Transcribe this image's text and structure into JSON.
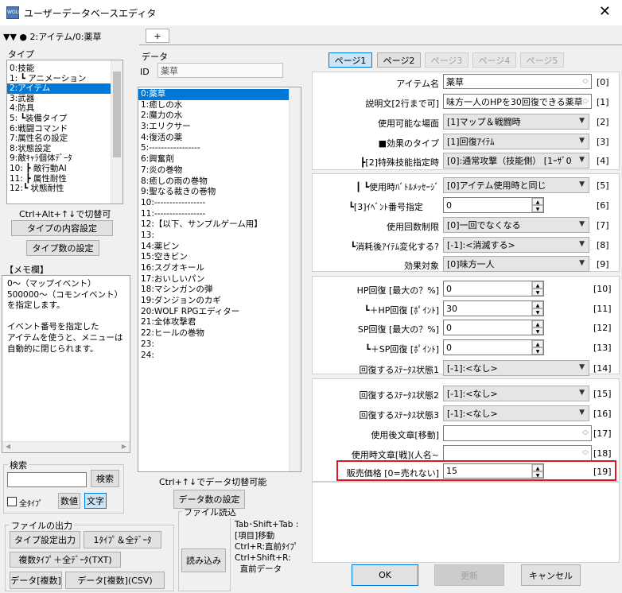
{
  "window": {
    "title": "ユーザーデータベースエディタ",
    "close": "✕",
    "app_icon": "WOLF"
  },
  "tabs": {
    "current": "▼▼ ● 2:アイテム/0:薬草",
    "add": "+"
  },
  "type_panel": {
    "label": "タイプ",
    "items": [
      "0:技能",
      "1: ┗ アニメーション",
      "2:アイテム",
      "3:武器",
      "4:防具",
      "5: ┗装備タイプ",
      "6:戦闘コマンド",
      "7:属性名の設定",
      "8:状態設定",
      "9:敵ｷｬﾗ個体ﾃﾞｰﾀ",
      "10: ┣ 敵行動AI",
      "11: ┣ 属性耐性",
      "12:┗ 状態耐性"
    ],
    "selected": 2,
    "hint": "Ctrl+Alt+↑↓で切替可",
    "content_button": "タイプの内容設定",
    "count_button": "タイプ数の設定"
  },
  "memo": {
    "label": "【メモ欄】",
    "lines": [
      "0～（マップイベント）",
      "500000～（コモンイベント）",
      "を指定します。",
      "",
      "イベント番号を指定した",
      "アイテムを使うと、メニューは",
      "自動的に閉じられます。"
    ]
  },
  "search": {
    "label": "検索",
    "button": "検索",
    "all_types": "全ﾀｲﾌﾟ",
    "numeric": "数値",
    "text": "文字"
  },
  "file_output": {
    "label": "ファイルの出力",
    "type_settings": "タイプ設定出力",
    "one_type_all": "1ﾀｲﾌﾟ＆全ﾃﾞｰﾀ",
    "multi_type": "複数ﾀｲﾌﾟ＋全ﾃﾞｰﾀ(TXT)",
    "data_multi": "データ[複数]",
    "data_multi_csv": "データ[複数](CSV)"
  },
  "file_read": {
    "label": "ファイル読込",
    "button": "読み込み"
  },
  "shortcuts": [
    "Tab･Shift+Tab :",
    "[項目]移動",
    "Ctrl+R:直前ﾀｲﾌﾟ",
    "Ctrl+Shift+R:",
    "  直前データ"
  ],
  "data_panel": {
    "label": "データ",
    "id_label": "ID",
    "id_value": "薬草",
    "items": [
      "0:薬草",
      "1:癒しの水",
      "2:魔力の水",
      "3:エリクサー",
      "4:復活の薬",
      "5:-----------------",
      "6:興奮剤",
      "7:炎の巻物",
      "8:癒しの雨の巻物",
      "9:聖なる裁きの巻物",
      "10:-----------------",
      "11:-----------------",
      "12:【以下、サンプルゲーム用】",
      "13:",
      "14:薬ビン",
      "15:空きビン",
      "16:スグオキール",
      "17:おいしいパン",
      "18:マシンガンの弾",
      "19:ダンジョンのカギ",
      "20:WOLF RPGエディター",
      "21:全体攻撃君",
      "22:ヒールの巻物",
      "23:",
      "24:"
    ],
    "selected": 0,
    "hint": "Ctrl+↑↓でデータ切替可能",
    "count_button": "データ数の設定"
  },
  "pages": [
    {
      "label": "ページ1",
      "state": "active"
    },
    {
      "label": "ページ2",
      "state": "normal"
    },
    {
      "label": "ページ3",
      "state": "disabled"
    },
    {
      "label": "ページ4",
      "state": "disabled"
    },
    {
      "label": "ページ5",
      "state": "disabled"
    }
  ],
  "fields": {
    "item_name": {
      "label": "アイテム名",
      "value": "薬草",
      "num": "[0]"
    },
    "description": {
      "label": "説明文[2行まで可]",
      "value": "味方一人のHPを30回復できる薬草",
      "num": "[1]"
    },
    "usable_scene": {
      "label": "使用可能な場面",
      "value": "[1]マップ＆戦闘時",
      "num": "[2]"
    },
    "effect_type": {
      "label": "■効果のタイプ",
      "value": "[1]回復ｱｲﾃﾑ",
      "num": "[3]"
    },
    "special_skill": {
      "label": "┣[2]特殊技能指定時",
      "value": "[0]:通常攻撃（技能側） [1ｰｻﾞ0",
      "num": "[4]"
    },
    "battle_message": {
      "label": "┃ ┗使用時ﾊﾞﾄﾙﾒｯｾｰｼﾞ",
      "value": "[0]アイテム使用時と同じ",
      "num": "[5]"
    },
    "event_number": {
      "label": "┗[3]ｲﾍﾞﾝﾄ番号指定",
      "value": "0",
      "num": "[6]"
    },
    "use_limit": {
      "label": "使用回数制限",
      "value": "[0]一回でなくなる",
      "num": "[7]"
    },
    "item_change": {
      "label": "┗消耗後ｱｲﾃﾑ変化する?",
      "value": "[-1]:<消滅する>",
      "num": "[8]"
    },
    "target": {
      "label": "効果対象",
      "value": "[0]味方一人",
      "num": "[9]"
    },
    "hp_max": {
      "label": "HP回復 [最大の？%]",
      "value": "0",
      "num": "[10]"
    },
    "hp_point": {
      "label": "┗＋HP回復 [ﾎﾟｲﾝﾄ]",
      "value": "30",
      "num": "[11]"
    },
    "sp_max": {
      "label": "SP回復 [最大の？%]",
      "value": "0",
      "num": "[12]"
    },
    "sp_point": {
      "label": "┗＋SP回復 [ﾎﾟｲﾝﾄ]",
      "value": "0",
      "num": "[13]"
    },
    "cure1": {
      "label": "回復するｽﾃｰﾀｽ状態1",
      "value": "[-1]:<なし>",
      "num": "[14]"
    },
    "cure2": {
      "label": "回復するｽﾃｰﾀｽ状態2",
      "value": "[-1]:<なし>",
      "num": "[15]"
    },
    "cure3": {
      "label": "回復するｽﾃｰﾀｽ状態3",
      "value": "[-1]:<なし>",
      "num": "[16]"
    },
    "post_use_move": {
      "label": "使用後文章[移動]",
      "value": "",
      "num": "[17]"
    },
    "use_battle_text": {
      "label": "使用時文章[戦](人名~",
      "value": "",
      "num": "[18]"
    },
    "sale_price": {
      "label": "販売価格 [0=売れない]",
      "value": "15",
      "num": "[19]"
    }
  },
  "buttons": {
    "ok": "OK",
    "update": "更新",
    "cancel": "キャンセル"
  },
  "colors": {
    "highlight": "#e0191d",
    "selection": "#0078d7"
  }
}
